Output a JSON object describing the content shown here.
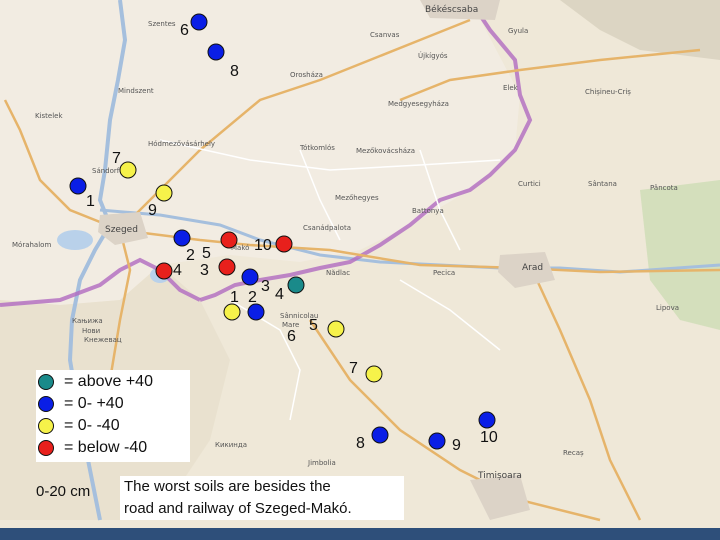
{
  "towns": {
    "szentes": "Szentes",
    "csanvas": "Csanvas",
    "bekescsaba": "Békéscsaba",
    "gyula": "Gyula",
    "ujkigyos": "Újkígyós",
    "oroshaza": "Orosháza",
    "mindszent": "Mindszent",
    "elek": "Elek",
    "chisineu": "Chișineu-Criș",
    "medgyesegyhaza": "Medgyesegyháza",
    "kistelek": "Kistelek",
    "hodmezovasarhely": "Hódmezővásárhely",
    "totkomlos": "Tótkomlós",
    "mezokovacshaza": "Mezőkovácsháza",
    "sandorfalva": "Sándorfalva",
    "curtici": "Curtici",
    "sarlana": "Sântana",
    "pancota": "Pâncota",
    "mezohegyes": "Mezőhegyes",
    "battonya": "Battonya",
    "szeged": "Szeged",
    "csanadpalota": "Csanádpalota",
    "mako": "Makó",
    "morahalom": "Mórahalom",
    "nadlac": "Nădlac",
    "pecica": "Pecica",
    "arad": "Arad",
    "kanjiza": "Кањижа",
    "novi": "Нови",
    "knezevac": "Кнежевац",
    "sannicolau": "Sânnicolau",
    "mare": "Mare",
    "lipova": "Lipova",
    "kikinda": "Кикинда",
    "jimbolia": "Jimbolia",
    "recas": "Recaș",
    "timisoara": "Timișoara"
  },
  "sample_points": [
    {
      "label": "1",
      "class": "0- +40"
    },
    {
      "label": "2",
      "class": "0- +40"
    },
    {
      "label": "3",
      "class": "below -40"
    },
    {
      "label": "4",
      "class": "below -40"
    },
    {
      "label": "5",
      "class": "below -40"
    },
    {
      "label": "6",
      "class": "0- +40"
    },
    {
      "label": "7",
      "class": "0- -40"
    },
    {
      "label": "8",
      "class": "0- +40"
    },
    {
      "label": "9",
      "class": "0- -40"
    },
    {
      "label": "10",
      "class": "below -40"
    },
    {
      "label": "1",
      "class": "0- -40"
    },
    {
      "label": "2",
      "class": "0- +40"
    },
    {
      "label": "3",
      "class": "0- +40"
    },
    {
      "label": "4",
      "class": "above +40"
    },
    {
      "label": "5",
      "class": "0- -40"
    },
    {
      "label": "6",
      "class": ""
    },
    {
      "label": "7",
      "class": "0- -40"
    },
    {
      "label": "8",
      "class": "0- +40"
    },
    {
      "label": "9",
      "class": "0- +40"
    },
    {
      "label": "10",
      "class": "0- +40"
    }
  ],
  "legend": {
    "above": {
      "text": "= above  +40",
      "color": "#1a8a8a"
    },
    "pos": {
      "text": "=  0-  +40",
      "color": "#0a1ee6"
    },
    "neg": {
      "text": "=  0-  -40",
      "color": "#f6f24a"
    },
    "below": {
      "text": "= below -40",
      "color": "#e8201c"
    }
  },
  "depth_label": "0-20 cm",
  "note_line1": "The worst soils are besides the",
  "note_line2": "road and railway of Szeged-Makó."
}
